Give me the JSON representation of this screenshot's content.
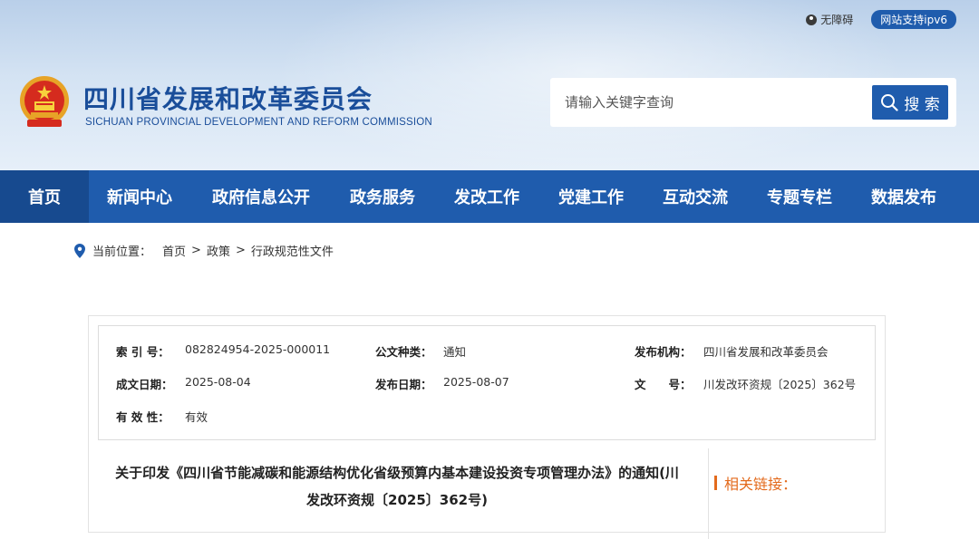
{
  "topbar": {
    "accessible": "无障碍",
    "ipv6": "网站支持ipv6"
  },
  "site": {
    "title": "四川省发展和改革委员会",
    "subtitle": "SICHUAN PROVINCIAL DEVELOPMENT AND REFORM COMMISSION"
  },
  "search": {
    "placeholder": "请输入关键字查询",
    "button": "搜 索"
  },
  "nav": {
    "items": [
      {
        "label": "首页"
      },
      {
        "label": "新闻中心"
      },
      {
        "label": "政府信息公开"
      },
      {
        "label": "政务服务"
      },
      {
        "label": "发改工作"
      },
      {
        "label": "党建工作"
      },
      {
        "label": "互动交流"
      },
      {
        "label": "专题专栏"
      },
      {
        "label": "数据发布"
      }
    ]
  },
  "breadcrumb": {
    "prefix": "当前位置：",
    "items": [
      "首页",
      "政策",
      "行政规范性文件"
    ],
    "sep": ">"
  },
  "meta": {
    "index_label": "索 引 号：",
    "index_value": "082824954-2025-000011",
    "type_label": "公文种类：",
    "type_value": "通知",
    "org_label": "发布机构：",
    "org_value": "四川省发展和改革委员会",
    "written_label": "成文日期：",
    "written_value": "2025-08-04",
    "pub_label": "发布日期：",
    "pub_value": "2025-08-07",
    "doc_label": "文　　号：",
    "doc_value": "川发改环资规〔2025〕362号",
    "valid_label": "有 效 性：",
    "valid_value": "有效"
  },
  "article": {
    "title_line1": "关于印发《四川省节能减碳和能源结构优化省级预算内基本建设投资专项管理办法》的通知(川",
    "title_line2": "发改环资规〔2025〕362号)"
  },
  "related": {
    "label": "相关链接："
  },
  "colors": {
    "primary": "#1f5cad",
    "accent": "#e36a1c"
  }
}
